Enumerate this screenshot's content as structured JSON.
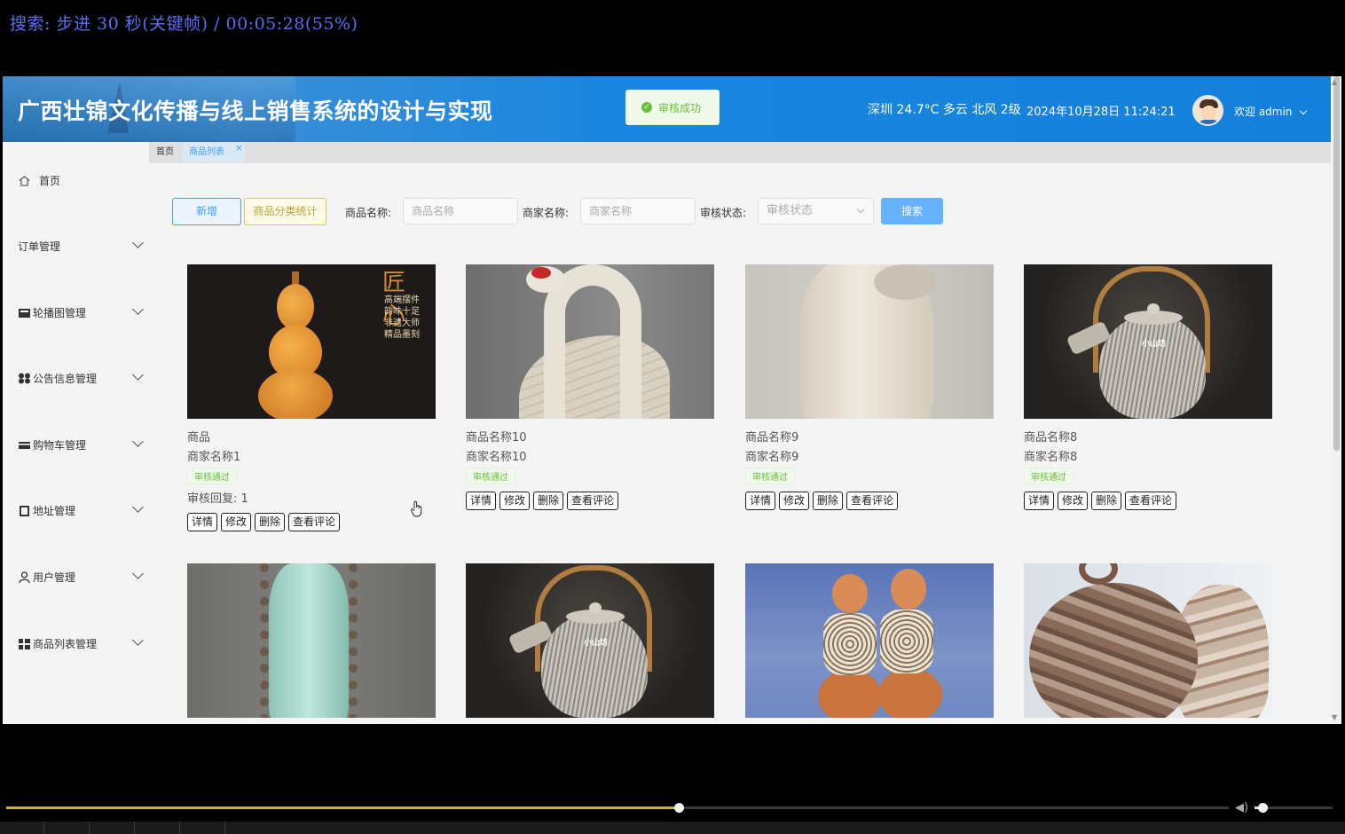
{
  "player": {
    "osd_text": "搜索: 步进 30 秒(关键帧) / 00:05:28(55%)",
    "progress_fraction": 0.55,
    "volume_fraction": 0.1
  },
  "header": {
    "title": "广西壮锦文化传播与线上销售系统的设计与实现",
    "weather": "深圳 24.7°C 多云 北风 2级",
    "datetime": "2024年10月28日 11:24:21",
    "welcome": "欢迎 admin",
    "toast": "审核成功"
  },
  "sidebar": {
    "items": [
      {
        "label": "首页",
        "icon": "home-icon"
      },
      {
        "label": "订单管理",
        "icon": ""
      },
      {
        "label": "轮播图管理",
        "icon": "carousel-icon"
      },
      {
        "label": "公告信息管理",
        "icon": "grid-icon"
      },
      {
        "label": "购物车管理",
        "icon": "cart-icon"
      },
      {
        "label": "地址管理",
        "icon": "address-icon"
      },
      {
        "label": "用户管理",
        "icon": "user-icon"
      },
      {
        "label": "商品列表管理",
        "icon": "list-icon"
      }
    ]
  },
  "tabs": [
    {
      "label": "首页"
    },
    {
      "label": "商品列表",
      "close": "×"
    }
  ],
  "toolbar": {
    "new_label": "新增",
    "stat_label": "商品分类统计",
    "goods_name_label": "商品名称:",
    "goods_name_placeholder": "商品名称",
    "shop_name_label": "商家名称:",
    "shop_name_placeholder": "商家名称",
    "audit_label": "审核状态:",
    "audit_placeholder": "审核状态",
    "search_label": "搜索"
  },
  "ops": {
    "detail": "详情",
    "edit": "修改",
    "delete": "删除",
    "comments": "查看评论"
  },
  "products": [
    {
      "name": "商品",
      "shop": "商家名称1",
      "status": "审核通过",
      "reply": "审核回复: 1",
      "art": "gourd"
    },
    {
      "name": "商品名称10",
      "shop": "商家名称10",
      "status": "审核通过",
      "art": "crane"
    },
    {
      "name": "商品名称9",
      "shop": "商家名称9",
      "status": "审核通过",
      "art": "vase"
    },
    {
      "name": "商品名称8",
      "shop": "商家名称8",
      "status": "审核通过",
      "art": "teapot"
    },
    {
      "art": "torso"
    },
    {
      "art": "teapot"
    },
    {
      "art": "dolls"
    },
    {
      "art": "jars"
    }
  ],
  "art_text": {
    "gourd_poem": "高端摆件 韵味十足 非遗大师 精品墨刻",
    "gourd_brush": "匠心",
    "tea_mark": "小山坊"
  }
}
